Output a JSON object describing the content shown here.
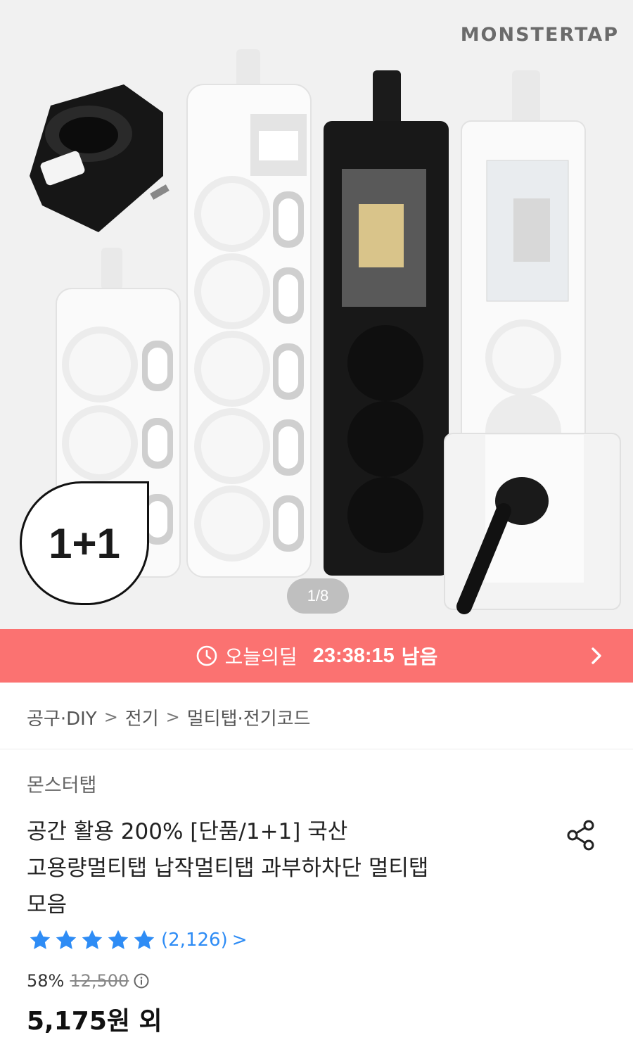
{
  "product_image": {
    "brand": "MONSTERTAP",
    "badge": "1+1",
    "pager": "1/8"
  },
  "deal_banner": {
    "icon": "clock-icon",
    "label": "오늘의딜",
    "countdown": "23:38:15",
    "suffix": "남음",
    "color": "#fb7271"
  },
  "breadcrumb": [
    "공구·DIY",
    "전기",
    "멀티탭·전기코드"
  ],
  "product": {
    "seller": "몬스터탭",
    "title_lines": [
      "공간 활용 200% [단품/1+1] 국산",
      "고용량멀티탭 납작멀티탭 과부하차단 멀티탭",
      "모음"
    ],
    "rating": {
      "stars": 5,
      "count": "(2,126)",
      "color": "#2e8cf5"
    },
    "discount": "58%",
    "original_price": "12,500",
    "price": "5,175원 외"
  }
}
